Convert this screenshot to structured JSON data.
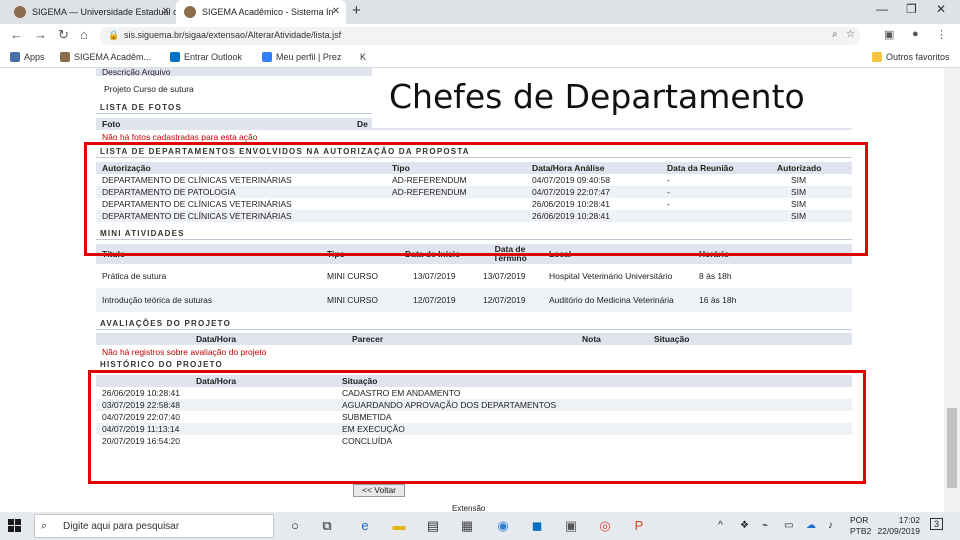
{
  "browser": {
    "tabs": [
      {
        "title": "SIGEMA — Universidade Estadual d",
        "active": false
      },
      {
        "title": "SIGEMA Acadêmico - Sistema In",
        "active": true
      }
    ],
    "url": "sis.siguema.br/sigaa/extensao/AlterarAtividade/lista.jsf",
    "bookmarks": [
      "Apps",
      "SIGEMA Acadêm...",
      "Entrar Outlook",
      "Meu perfil | Prez",
      "K",
      "Outros favoritos"
    ]
  },
  "page": {
    "overlay_title": "Chefes de Departamento",
    "top_fragment": {
      "line1": "Descrição Arquivo",
      "line2": "Projeto Curso de sutura"
    },
    "fotos": {
      "title": "Lista de Fotos",
      "headers": [
        "Foto",
        "De"
      ],
      "empty_msg": "Não há fotos cadastradas para esta ação"
    },
    "departamentos": {
      "title": "Lista de Departamentos Envolvidos na Autorização da Proposta",
      "headers": [
        "Autorização",
        "Tipo",
        "Data/Hora Análise",
        "Data da Reunião",
        "Autorizado"
      ],
      "rows": [
        [
          "DEPARTAMENTO DE CLÍNICAS VETERINÁRIAS",
          "AD-REFERENDUM",
          "04/07/2019 09:40:58",
          "-",
          "SIM"
        ],
        [
          "DEPARTAMENTO DE PATOLOGIA",
          "AD-REFERENDUM",
          "04/07/2019 22:07:47",
          "-",
          "SIM"
        ],
        [
          "DEPARTAMENTO DE CLÍNICAS VETERINÁRIAS",
          "",
          "26/06/2019 10:28:41",
          "-",
          "SIM"
        ],
        [
          "DEPARTAMENTO DE CLÍNICAS VETERINÁRIAS",
          "",
          "26/06/2019 10:28:41",
          "",
          "SIM"
        ]
      ]
    },
    "mini": {
      "title": "Mini Atividades",
      "headers": [
        "Título",
        "Tipo",
        "Data de Início",
        "Data de Término",
        "Local",
        "Horário"
      ],
      "rows": [
        [
          "Prática de sutura",
          "MINI CURSO",
          "13/07/2019",
          "13/07/2019",
          "Hospital Veterinário Universitário",
          "8 às 18h"
        ],
        [
          "Introdução teórica de suturas",
          "MINI CURSO",
          "12/07/2019",
          "12/07/2019",
          "Auditório do Medicina Veterinária",
          "16 às 18h"
        ]
      ]
    },
    "avaliacoes": {
      "title": "Avaliações do Projeto",
      "headers": [
        "Data/Hora",
        "Parecer",
        "Nota",
        "Situação"
      ],
      "empty_msg": "Não há registros sobre avaliação do projeto"
    },
    "historico": {
      "title": "Histórico do Projeto",
      "headers": [
        "Data/Hora",
        "Situação"
      ],
      "rows": [
        [
          "26/06/2019 10:28:41",
          "CADASTRO EM ANDAMENTO"
        ],
        [
          "03/07/2019 22:58:48",
          "AGUARDANDO APROVAÇÃO DOS DEPARTAMENTOS"
        ],
        [
          "04/07/2019 22:07:40",
          "SUBMETIDA"
        ],
        [
          "04/07/2019 11:13:14",
          "EM EXECUÇÃO"
        ],
        [
          "20/07/2019 16:54:20",
          "CONCLUÍDA"
        ]
      ]
    },
    "back_label": "<< Voltar",
    "footer_fragment": "Extensão"
  },
  "taskbar": {
    "search_placeholder": "Digite aqui para pesquisar",
    "lang": "POR",
    "lang2": "PTB2",
    "time": "17:02",
    "date": "22/09/2019",
    "notif_count": "3"
  },
  "colors": {
    "highlight_box": "#e00000",
    "header_bg": "#dfe4ee"
  }
}
